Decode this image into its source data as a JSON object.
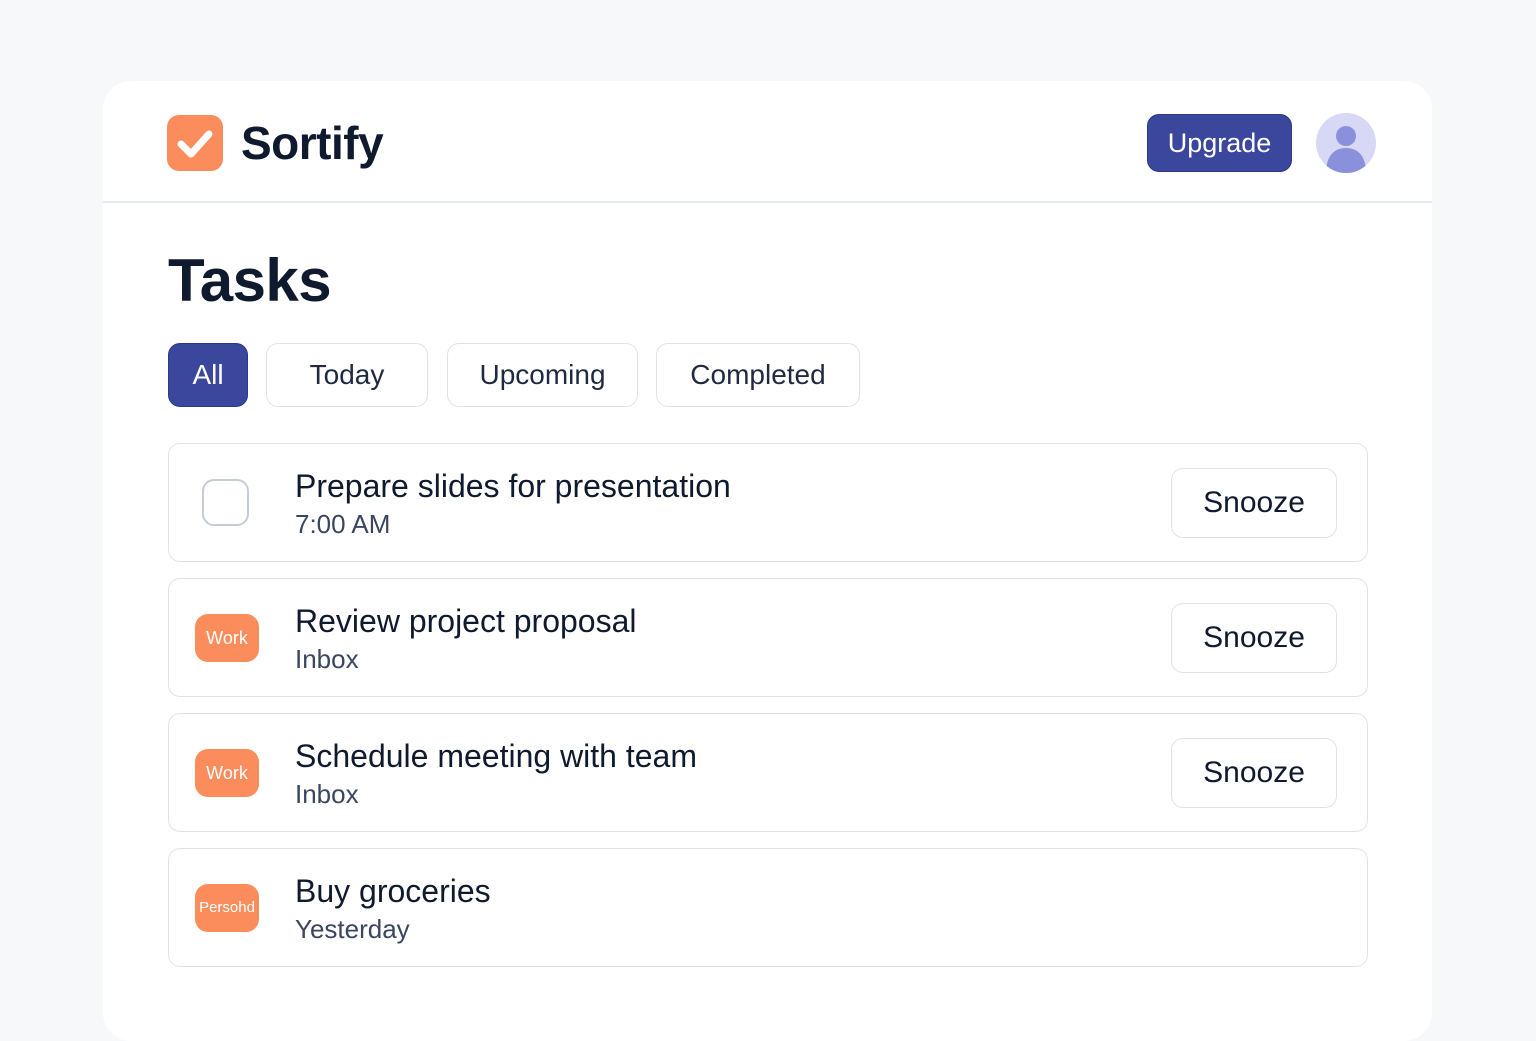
{
  "app": {
    "name": "Sortify",
    "logo_icon": "checkmark-icon",
    "accent_color": "#fb8d5c",
    "primary_color": "#3a479c"
  },
  "header": {
    "upgrade_label": "Upgrade",
    "avatar_icon": "user-icon"
  },
  "page": {
    "title": "Tasks"
  },
  "filters": [
    {
      "label": "All",
      "active": true
    },
    {
      "label": "Today",
      "active": false
    },
    {
      "label": "Upcoming",
      "active": false
    },
    {
      "label": "Completed",
      "active": false
    }
  ],
  "tasks": [
    {
      "title": "Prepare slides for presentation",
      "subtitle": "7:00 AM",
      "marker": "checkbox",
      "checked": false,
      "action": "Snooze"
    },
    {
      "title": "Review project proposal",
      "subtitle": "Inbox",
      "marker": "tag",
      "tag": "Work",
      "action": "Snooze"
    },
    {
      "title": "Schedule meeting with team",
      "subtitle": "Inbox",
      "marker": "tag",
      "tag": "Work",
      "action": "Snooze"
    },
    {
      "title": "Buy groceries",
      "subtitle": "Yesterday",
      "marker": "tag",
      "tag": "Persohd",
      "action": ""
    }
  ]
}
